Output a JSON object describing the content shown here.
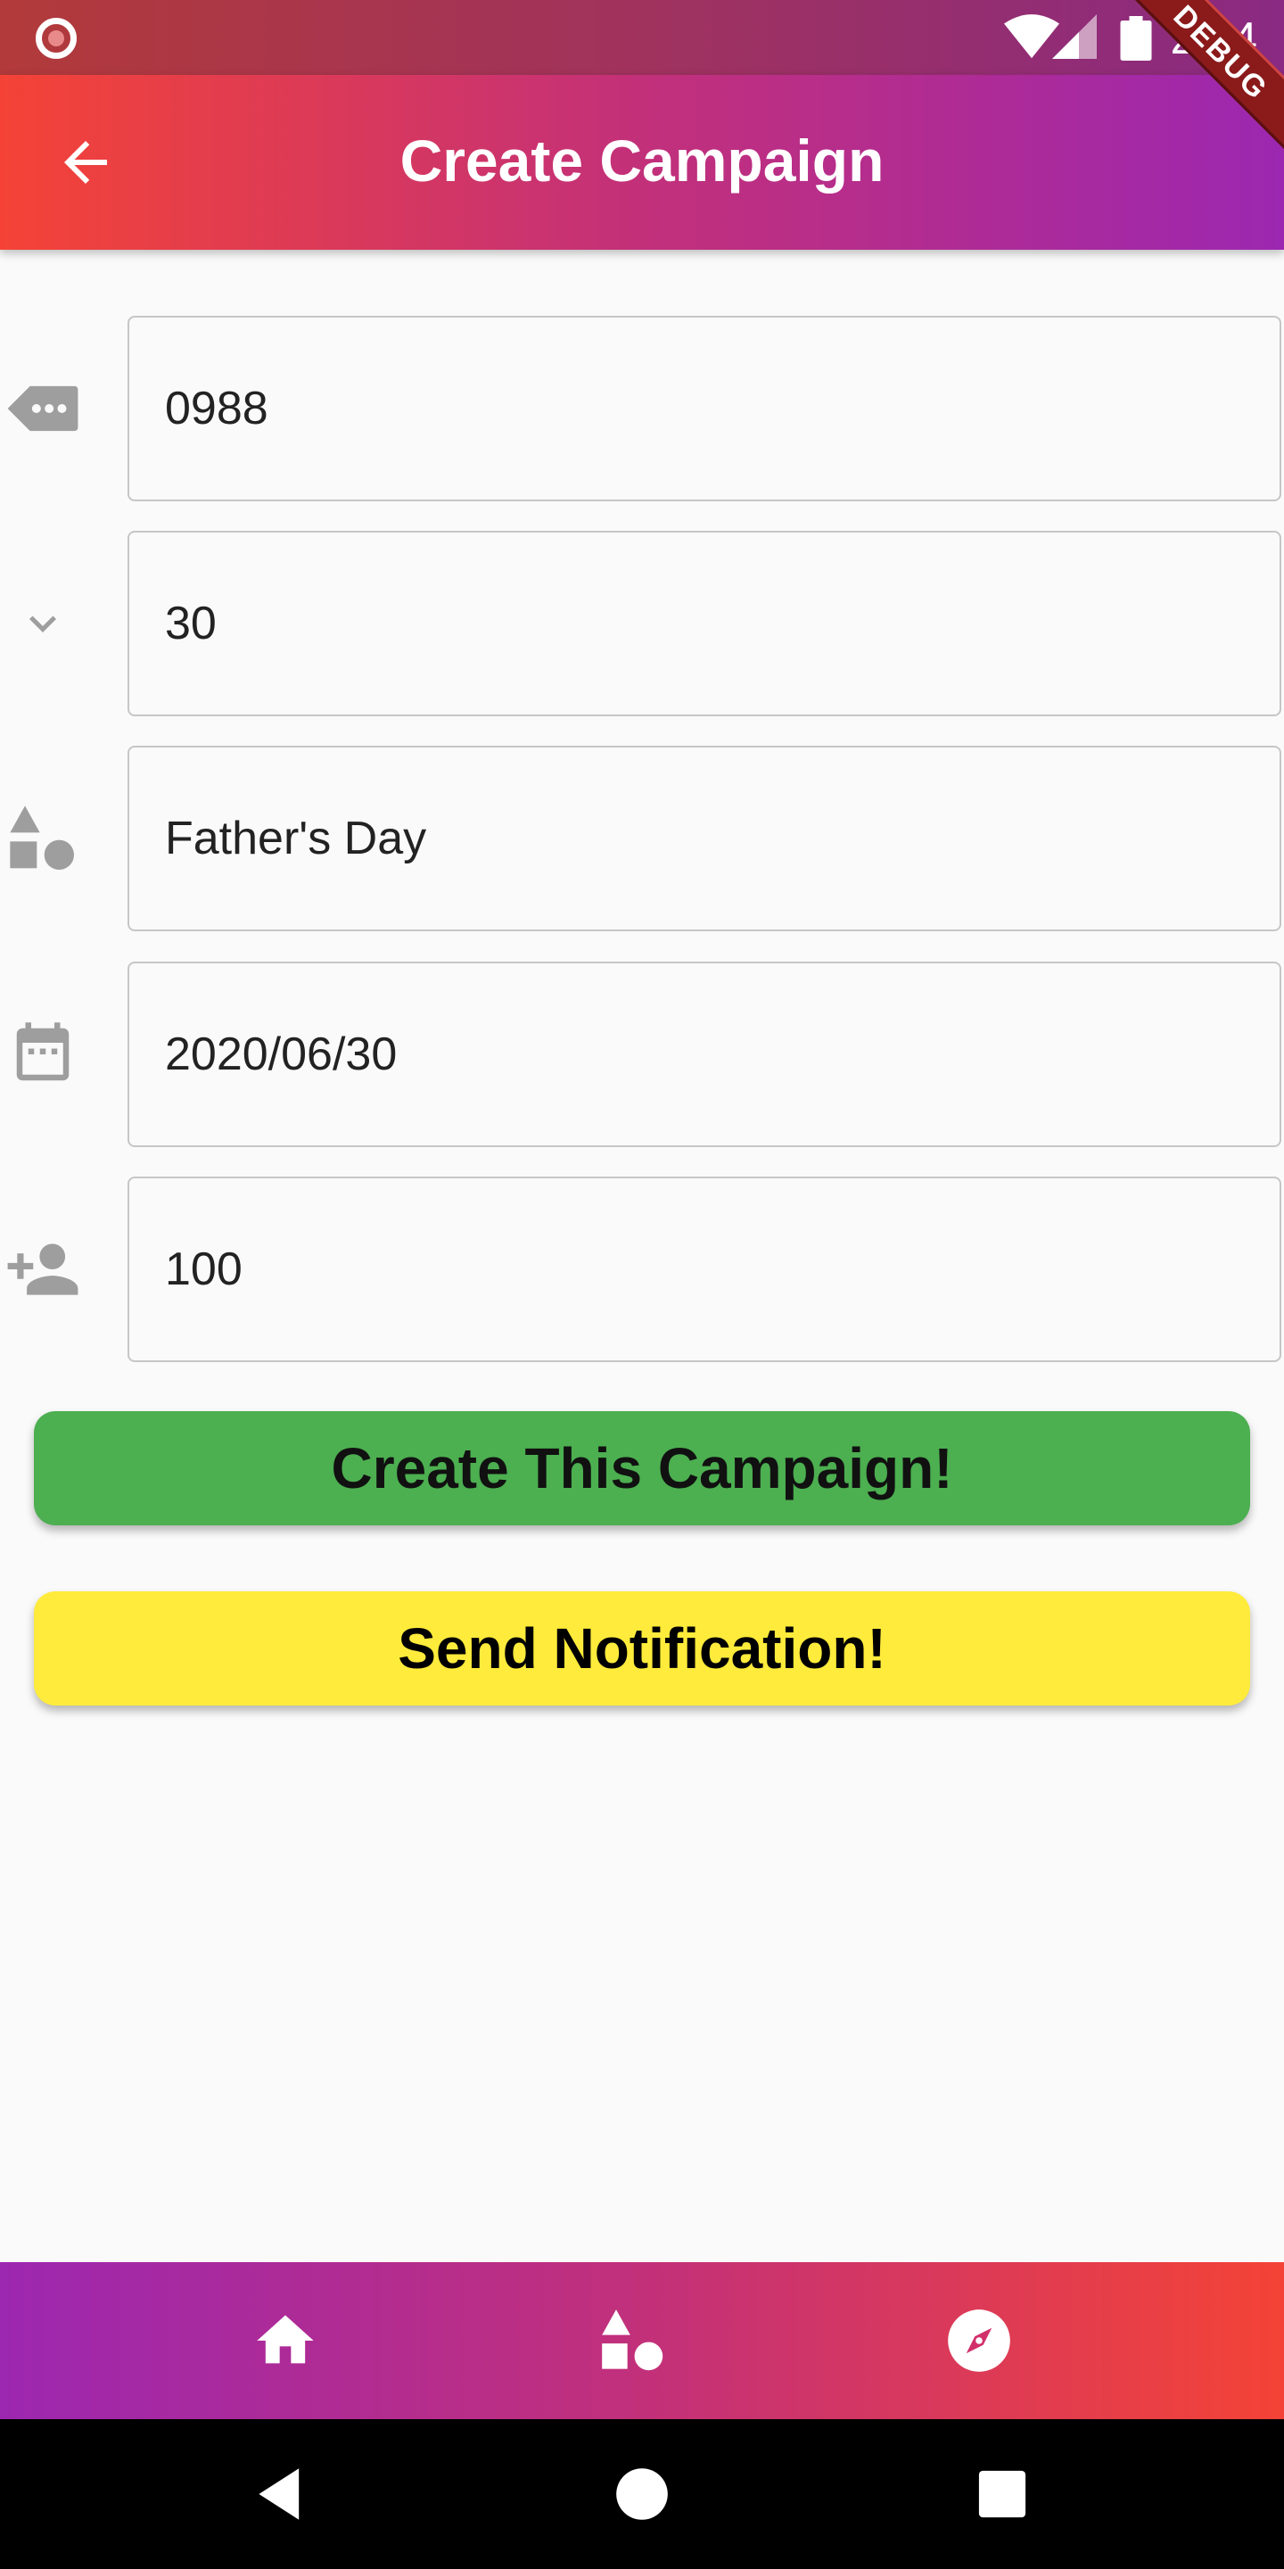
{
  "status_bar": {
    "time": "2:24"
  },
  "debug_banner": "DEBUG",
  "app_bar": {
    "title": "Create Campaign"
  },
  "form": {
    "fields": [
      {
        "icon": "tag-icon",
        "value": "0988"
      },
      {
        "icon": "chevron-down-icon",
        "value": "30"
      },
      {
        "icon": "shapes-icon",
        "value": "Father's Day"
      },
      {
        "icon": "calendar-icon",
        "value": "2020/06/30"
      },
      {
        "icon": "person-add-icon",
        "value": "100"
      }
    ]
  },
  "buttons": {
    "create": "Create This Campaign!",
    "notify": "Send Notification!"
  },
  "bottom_nav": [
    "home-icon",
    "shapes-icon",
    "compass-icon"
  ],
  "colors": {
    "create_button": "#4caf50",
    "notify_button": "#ffeb3b",
    "gradient_start": "#f44336",
    "gradient_end": "#9c27b0"
  }
}
